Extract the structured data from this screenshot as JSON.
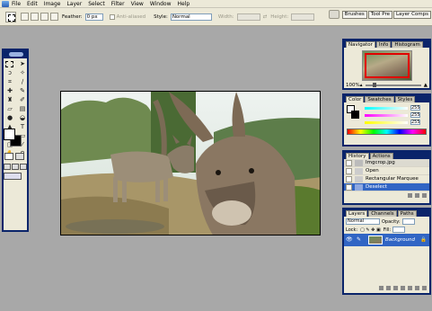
{
  "menu": [
    "File",
    "Edit",
    "Image",
    "Layer",
    "Select",
    "Filter",
    "View",
    "Window",
    "Help"
  ],
  "options": {
    "feather_label": "Feather:",
    "feather_value": "0 px",
    "antialiased_label": "Anti-aliased",
    "style_label": "Style:",
    "style_value": "Normal",
    "width_label": "Width:",
    "height_label": "Height:"
  },
  "palette_well": [
    "Brushes",
    "Tool Pre",
    "Layer Comps"
  ],
  "navigator": {
    "tabs": [
      "Navigator",
      "Info",
      "Histogram"
    ],
    "zoom": "100%"
  },
  "color": {
    "tabs": [
      "Color",
      "Swatches",
      "Styles"
    ],
    "r": "255",
    "g": "255",
    "b": "255"
  },
  "history": {
    "tabs": [
      "History",
      "Actions"
    ],
    "items": [
      "Imgcrop.jpg",
      "Open",
      "Rectangular Marquee",
      "Deselect"
    ],
    "selected_index": 3
  },
  "layers": {
    "tabs": [
      "Layers",
      "Channels",
      "Paths"
    ],
    "blend_mode": "Normal",
    "opacity_label": "Opacity:",
    "lock_label": "Lock:",
    "fill_label": "Fill:",
    "layer_name": "Background"
  },
  "image": {
    "subject": "two donkeys in a field"
  },
  "colors": {
    "titlebar": "#0a246a",
    "selection": "#3165c4",
    "ui_bg": "#ece9d8",
    "workspace": "#a8a8a8"
  }
}
